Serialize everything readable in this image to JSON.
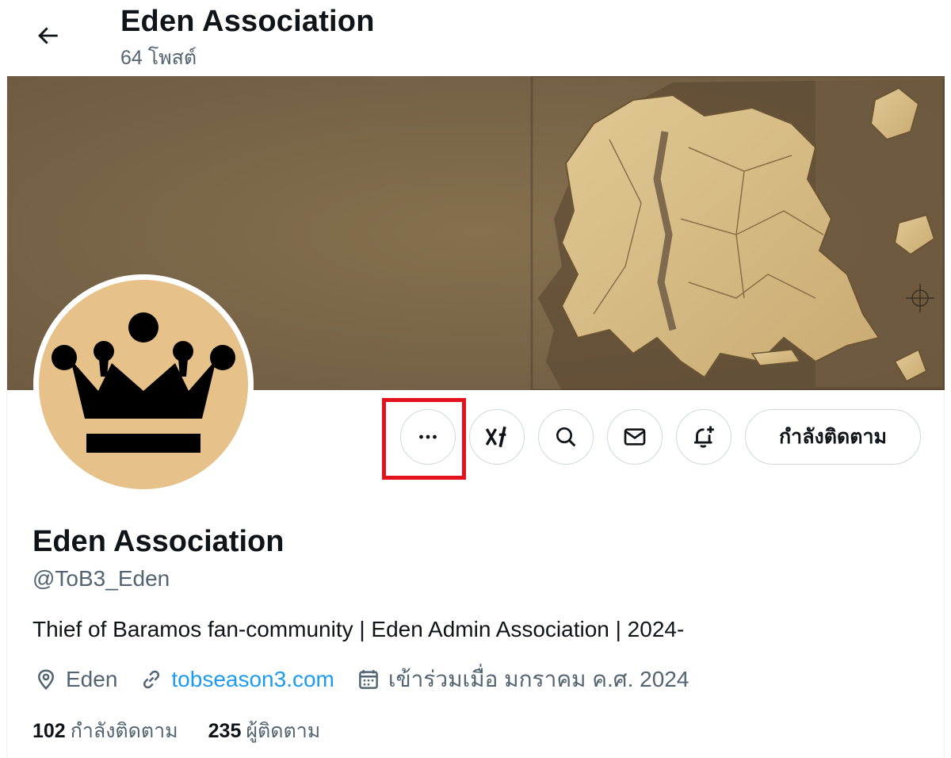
{
  "header": {
    "title": "Eden Association",
    "post_count": "64 โพสต์",
    "back_icon": "arrow-left-icon"
  },
  "actions": {
    "more_icon": "more-horizontal-icon",
    "grok_icon": "grok-icon",
    "search_icon": "search-icon",
    "message_icon": "envelope-icon",
    "notify_icon": "bell-plus-icon",
    "follow_label": "กำลังติดตาม",
    "highlight_color": "#e3131d"
  },
  "profile": {
    "name": "Eden Association",
    "handle": "@ToB3_Eden",
    "bio": "Thief of Baramos fan-community | Eden Admin Association | 2024-",
    "location": "Eden",
    "website": "tobseason3.com",
    "joined": "เข้าร่วมเมื่อ มกราคม ค.ศ. 2024",
    "avatar_bg": "#e6c28a",
    "avatar_icon": "crown-icon"
  },
  "stats": {
    "following_count": "102",
    "following_label": "กำลังติดตาม",
    "followers_count": "235",
    "followers_label": "ผู้ติดตาม"
  },
  "colors": {
    "link": "#1d9bf0",
    "secondary_text": "#536471",
    "border": "#cfd9de",
    "banner_bg": "#7f6a4f"
  }
}
